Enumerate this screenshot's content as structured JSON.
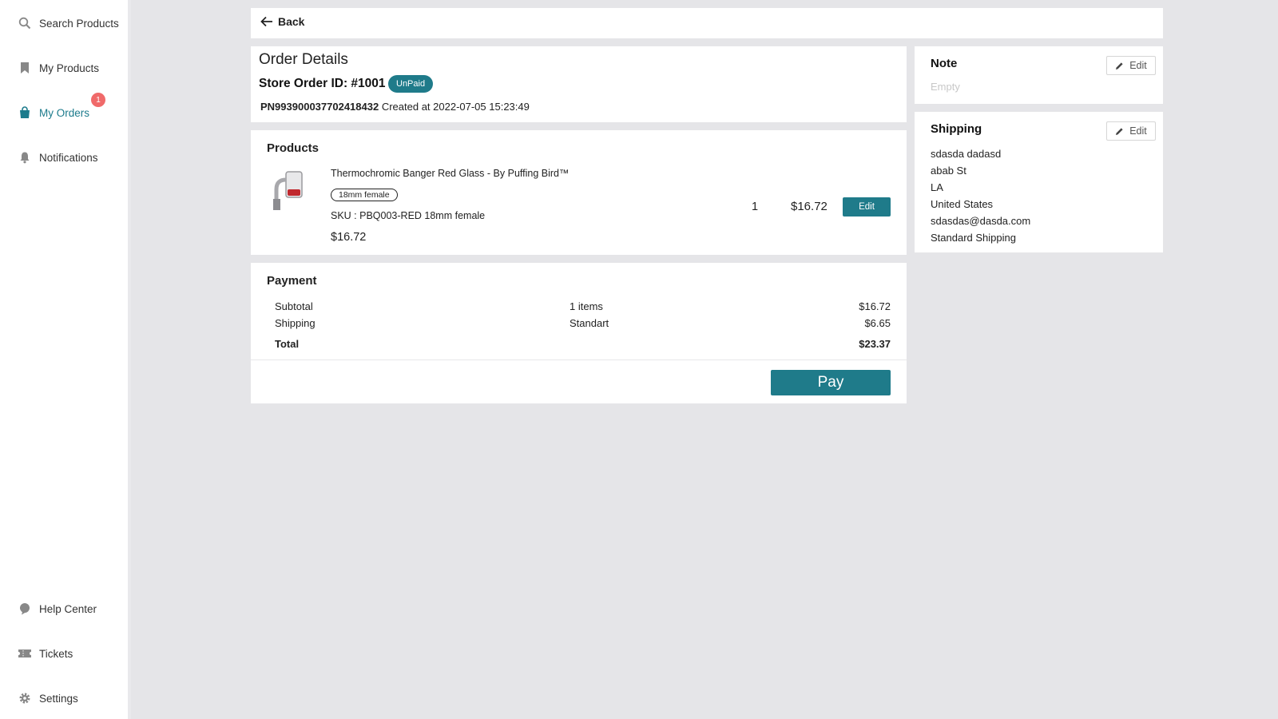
{
  "sidebar": {
    "items": [
      {
        "label": "Search Products",
        "icon": "search-icon"
      },
      {
        "label": "My Products",
        "icon": "bookmark-icon"
      },
      {
        "label": "My Orders",
        "icon": "shopping-bag-icon",
        "badge": "1",
        "active": true
      },
      {
        "label": "Notifications",
        "icon": "bell-icon"
      }
    ],
    "bottom_items": [
      {
        "label": "Help Center",
        "icon": "help-bubble-icon"
      },
      {
        "label": "Tickets",
        "icon": "ticket-icon"
      },
      {
        "label": "Settings",
        "icon": "gear-icon"
      }
    ]
  },
  "header": {
    "back_label": "Back"
  },
  "order": {
    "title": "Order Details",
    "store_order_id": "Store Order ID: #1001",
    "status": "UnPaid",
    "order_number": "PN993900037702418432",
    "created": "Created at 2022-07-05 15:23:49"
  },
  "products": {
    "title": "Products",
    "items": [
      {
        "name": "Thermochromic Banger Red Glass - By Puffing Bird™",
        "variant": "18mm female",
        "sku": "SKU : PBQ003-RED 18mm female",
        "price": "$16.72",
        "quantity": "1",
        "line_total": "$16.72",
        "edit_label": "Edit"
      }
    ]
  },
  "payment": {
    "title": "Payment",
    "subtotal": {
      "label": "Subtotal",
      "detail": "1 items",
      "amount": "$16.72"
    },
    "shipping": {
      "label": "Shipping",
      "detail": "Standart",
      "amount": "$6.65"
    },
    "total": {
      "label": "Total",
      "amount": "$23.37"
    },
    "pay_label": "Pay"
  },
  "note": {
    "title": "Note",
    "edit_label": "Edit",
    "value": "Empty"
  },
  "shipping": {
    "title": "Shipping",
    "edit_label": "Edit",
    "name": "sdasda dadasd",
    "street": "abab St",
    "city": "LA",
    "country": "United States",
    "email": "sdasdas@dasda.com",
    "method": "Standard Shipping"
  },
  "colors": {
    "accent": "#1f7b8a",
    "badge": "#f06a6a",
    "background": "#e5e5e8"
  }
}
